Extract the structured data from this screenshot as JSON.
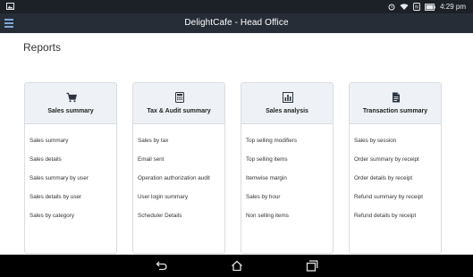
{
  "status": {
    "time": "4:29 pm"
  },
  "appbar": {
    "title": "DelightCafe - Head Office"
  },
  "page": {
    "title": "Reports"
  },
  "cards": [
    {
      "heading": "Sales summary",
      "icon": "cart-icon",
      "items": [
        "Sales summary",
        "Sales details",
        "Sales summary by user",
        "Sales details by user",
        "Sales by category"
      ]
    },
    {
      "heading": "Tax & Audit summary",
      "icon": "calculator-icon",
      "items": [
        "Sales by tax",
        "Email sent",
        "Operation authorization audit",
        "User login summary",
        "Scheduler Details"
      ]
    },
    {
      "heading": "Sales analysis",
      "icon": "bar-chart-icon",
      "items": [
        "Top selling modifiers",
        "Top selling items",
        "Itemwise margin",
        "Sales by hour",
        "Non selling items"
      ]
    },
    {
      "heading": "Transaction summary",
      "icon": "document-icon",
      "items": [
        "Sales by session",
        "Order summary by receipt",
        "Order details by receipt",
        "Refund summary by receipt",
        "Refund details by receipt"
      ]
    }
  ],
  "colors": {
    "statusbar": "#1c2127",
    "appbar": "#262d36",
    "card_header": "#eef1f5",
    "navbar": "#000000"
  }
}
